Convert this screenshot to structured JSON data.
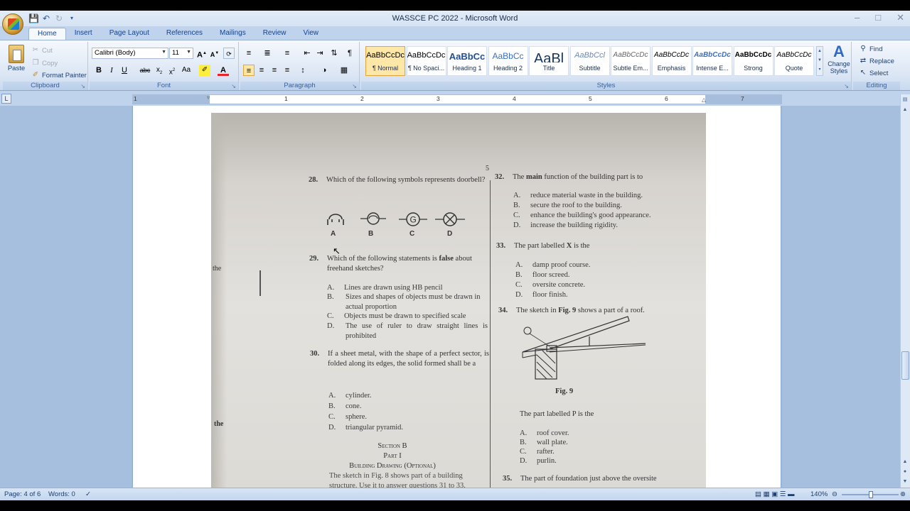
{
  "window": {
    "title": "WASSCE PC 2022 - Microsoft Word"
  },
  "tabs": [
    "Home",
    "Insert",
    "Page Layout",
    "References",
    "Mailings",
    "Review",
    "View"
  ],
  "active_tab": "Home",
  "ribbon": {
    "clipboard": {
      "label": "Clipboard",
      "paste": "Paste",
      "cut": "Cut",
      "copy": "Copy",
      "format_painter": "Format Painter"
    },
    "font": {
      "label": "Font",
      "font_name": "Calibri (Body)",
      "font_size": "11"
    },
    "paragraph": {
      "label": "Paragraph"
    },
    "styles": {
      "label": "Styles",
      "items": [
        {
          "sample": "AaBbCcDc",
          "name": "¶ Normal"
        },
        {
          "sample": "AaBbCcDc",
          "name": "¶ No Spaci..."
        },
        {
          "sample": "AaBbCc",
          "name": "Heading 1"
        },
        {
          "sample": "AaBbCc",
          "name": "Heading 2"
        },
        {
          "sample": "AaBl",
          "name": "Title"
        },
        {
          "sample": "AaBbCcl",
          "name": "Subtitle"
        },
        {
          "sample": "AaBbCcDc",
          "name": "Subtle Em..."
        },
        {
          "sample": "AaBbCcDc",
          "name": "Emphasis"
        },
        {
          "sample": "AaBbCcDc",
          "name": "Intense E..."
        },
        {
          "sample": "AaBbCcDc",
          "name": "Strong"
        },
        {
          "sample": "AaBbCcDc",
          "name": "Quote"
        }
      ],
      "change_styles": "Change Styles"
    },
    "editing": {
      "label": "Editing",
      "find": "Find",
      "replace": "Replace",
      "select": "Select"
    }
  },
  "ruler": {
    "numbers": [
      "1",
      "1",
      "2",
      "3",
      "4",
      "5",
      "6",
      "7"
    ]
  },
  "document": {
    "page_number": "5",
    "q28": {
      "num": "28.",
      "text": "Which of the following symbols represents doorbell?",
      "labels": [
        "A",
        "B",
        "C",
        "D"
      ]
    },
    "q29": {
      "num": "29.",
      "text_a": "Which of the following statements is ",
      "bold": "false",
      "text_b": " about freehand sketches?",
      "options": [
        {
          "letter": "A.",
          "text": "Lines are drawn using HB pencil"
        },
        {
          "letter": "B.",
          "text": "Sizes and shapes of objects must be drawn in actual proportion"
        },
        {
          "letter": "C.",
          "text": "Objects must be drawn to specified scale"
        },
        {
          "letter": "D.",
          "text": "The use of ruler to draw straight lines is prohibited"
        }
      ]
    },
    "q30": {
      "num": "30.",
      "text": "If a sheet metal, with the shape of a perfect sector, is folded along its edges, the solid formed shall be a",
      "options": [
        {
          "letter": "A.",
          "text": "cylinder."
        },
        {
          "letter": "B.",
          "text": "cone."
        },
        {
          "letter": "C.",
          "text": "sphere."
        },
        {
          "letter": "D.",
          "text": "triangular pyramid."
        }
      ]
    },
    "section_b": {
      "title": "Section B",
      "part": "Part I",
      "subtitle": "Building Drawing (Optional)",
      "intro": "The sketch in Fig. 8 shows part of a building structure. Use it to answer questions 31 to 33."
    },
    "q32": {
      "num": "32.",
      "text_a": "The ",
      "bold": "main",
      "text_b": " function of the building part is to",
      "options": [
        {
          "letter": "A.",
          "text": "reduce material waste in the building."
        },
        {
          "letter": "B.",
          "text": "secure the roof to the building."
        },
        {
          "letter": "C.",
          "text": "enhance the building's good appearance."
        },
        {
          "letter": "D.",
          "text": "increase the building rigidity."
        }
      ]
    },
    "q33": {
      "num": "33.",
      "text_a": "The part labelled ",
      "bold": "X",
      "text_b": " is the",
      "options": [
        {
          "letter": "A.",
          "text": "damp proof course."
        },
        {
          "letter": "B.",
          "text": "floor screed."
        },
        {
          "letter": "C.",
          "text": "oversite concrete."
        },
        {
          "letter": "D.",
          "text": "floor finish."
        }
      ]
    },
    "q34": {
      "num": "34.",
      "text_a": "The sketch in ",
      "bold": "Fig. 9",
      "text_b": " shows a part of a roof.",
      "fig": "Fig. 9",
      "sub": "The part labelled P is the",
      "options": [
        {
          "letter": "A.",
          "text": "roof cover."
        },
        {
          "letter": "B.",
          "text": "wall plate."
        },
        {
          "letter": "C.",
          "text": "rafter."
        },
        {
          "letter": "D.",
          "text": "purlin."
        }
      ]
    },
    "q35": {
      "num": "35.",
      "text": "The part of foundation just above the oversite"
    },
    "margin_words": [
      "the",
      "the"
    ]
  },
  "status": {
    "page": "Page: 4 of 6",
    "words": "Words: 0",
    "zoom": "140%"
  }
}
